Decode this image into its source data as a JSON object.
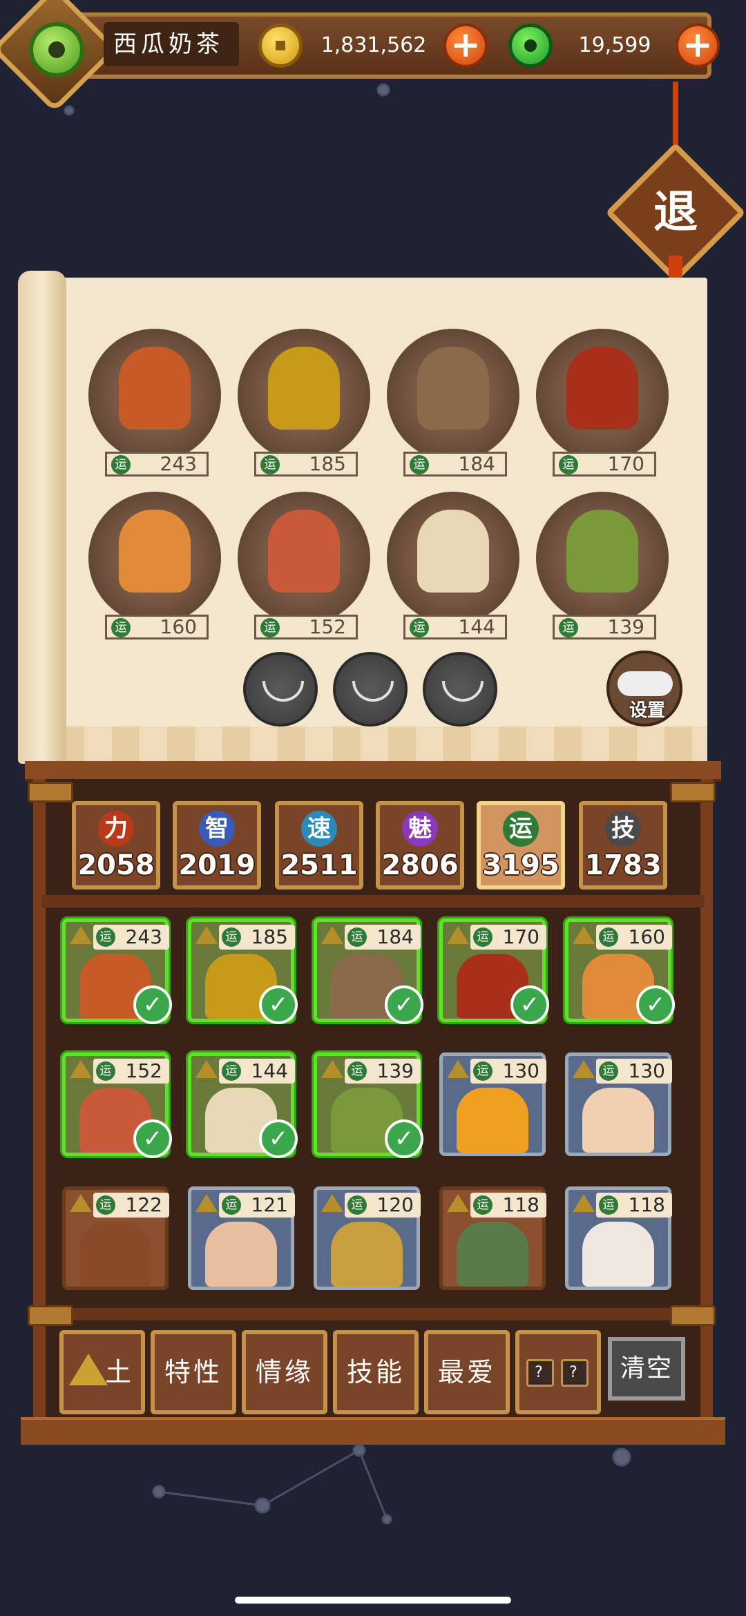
{
  "header": {
    "player_name": "西瓜奶茶",
    "gold_amount": "1,831,562",
    "jade_amount": "19,599",
    "plus_label": "+"
  },
  "exit_label": "退",
  "settings_label": "设置",
  "team": [
    {
      "score": "243",
      "color": "#c85a28"
    },
    {
      "score": "185",
      "color": "#c89a1a"
    },
    {
      "score": "184",
      "color": "#8a6a4a"
    },
    {
      "score": "170",
      "color": "#a8301a"
    },
    {
      "score": "160",
      "color": "#e08a3a"
    },
    {
      "score": "152",
      "color": "#c85a3a"
    },
    {
      "score": "144",
      "color": "#e8d8b8"
    },
    {
      "score": "139",
      "color": "#7a9a3a"
    }
  ],
  "luck_icon": "运",
  "stats": [
    {
      "icon": "力",
      "value": "2058",
      "color": "#b83a1a"
    },
    {
      "icon": "智",
      "value": "2019",
      "color": "#3a5ab8"
    },
    {
      "icon": "速",
      "value": "2511",
      "color": "#2a8ab8"
    },
    {
      "icon": "魅",
      "value": "2806",
      "color": "#8a3ab8"
    },
    {
      "icon": "运",
      "value": "3195",
      "color": "#2e7a36",
      "active": true
    },
    {
      "icon": "技",
      "value": "1783",
      "color": "#4a4a4a"
    }
  ],
  "roster": [
    {
      "score": "243",
      "selected": true,
      "color": "#c85a28"
    },
    {
      "score": "185",
      "selected": true,
      "color": "#c89a1a"
    },
    {
      "score": "184",
      "selected": true,
      "color": "#8a6a4a"
    },
    {
      "score": "170",
      "selected": true,
      "color": "#a8301a"
    },
    {
      "score": "160",
      "selected": true,
      "color": "#e08a3a"
    },
    {
      "score": "152",
      "selected": true,
      "color": "#c85a3a"
    },
    {
      "score": "144",
      "selected": true,
      "color": "#e8d8b8"
    },
    {
      "score": "139",
      "selected": true,
      "color": "#7a9a3a"
    },
    {
      "score": "130",
      "selected": false,
      "blue": true,
      "color": "#f0a020"
    },
    {
      "score": "130",
      "selected": false,
      "blue": true,
      "color": "#f0d0b0"
    },
    {
      "score": "122",
      "selected": false,
      "color": "#8a4a2a"
    },
    {
      "score": "121",
      "selected": false,
      "blue": true,
      "color": "#e8c0a0"
    },
    {
      "score": "120",
      "selected": false,
      "blue": true,
      "color": "#c8a040"
    },
    {
      "score": "118",
      "selected": false,
      "color": "#5a7a4a"
    },
    {
      "score": "118",
      "selected": false,
      "blue": true,
      "color": "#f0e8e0"
    }
  ],
  "filters": {
    "earth": "土",
    "trait": "特性",
    "bond": "情缘",
    "skill": "技能",
    "favorite": "最爱",
    "unknown": "?",
    "clear": "清空"
  },
  "colors": {
    "accent": "#5ee32a",
    "wood": "#7a4428",
    "gold": "#c6924a"
  }
}
